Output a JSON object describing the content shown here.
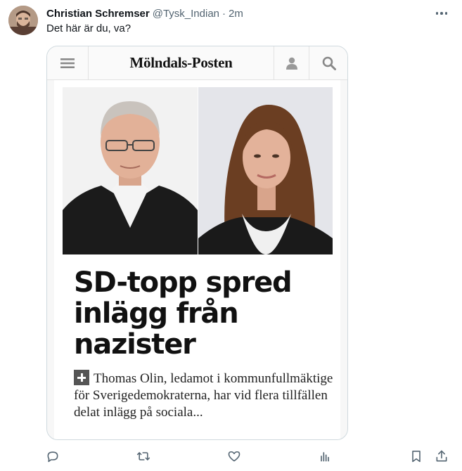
{
  "tweet": {
    "display_name": "Christian Schremser",
    "handle": "@Tysk_Indian",
    "separator": "·",
    "time": "2m",
    "text": "Det här är du, va?"
  },
  "media": {
    "site_name": "Mölndals-Posten",
    "headline": "SD-topp spred inlägg från nazister",
    "lead": "Thomas Olin, ledamot i kommunfullmäktige för Sverigedemokraterna, har vid flera tillfällen delat inlägg på sociala..."
  },
  "icons": {
    "more": "more-horizontal-icon",
    "menu": "hamburger-menu-icon",
    "user": "user-icon",
    "search": "search-icon",
    "plus": "plus-icon",
    "reply": "reply-icon",
    "retweet": "retweet-icon",
    "like": "heart-icon",
    "views": "analytics-icon",
    "bookmark": "bookmark-icon",
    "share": "share-icon"
  },
  "colors": {
    "text": "#0f1419",
    "secondary": "#536471",
    "border": "#cfd9de"
  }
}
